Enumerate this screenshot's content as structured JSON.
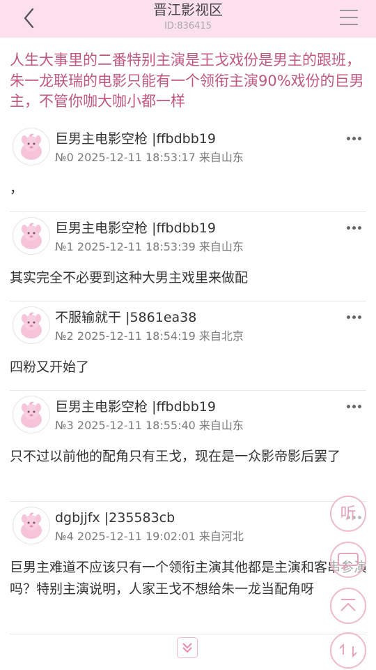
{
  "header": {
    "title": "晋江影视区",
    "thread_id": "ID:836415"
  },
  "thread": {
    "title": "人生大事里的二番特别主演是王戈戏份是男主的跟班，朱一龙联瑞的电影只能有一个领衔主演90%戏份的巨男主，不管你咖大咖小都一样"
  },
  "posts": [
    {
      "author": "巨男主电影空枪",
      "user_hash": "|ffbdbb19",
      "meta": "№0 2025-12-11 18:53:17 来自山东",
      "content": "，"
    },
    {
      "author": "巨男主电影空枪",
      "user_hash": "|ffbdbb19",
      "meta": "№1 2025-12-11 18:53:39 来自山东",
      "content": "其实完全不必要到这种大男主戏里来做配"
    },
    {
      "author": "不服输就干",
      "user_hash": "|5861ea38",
      "meta": "№2 2025-12-11 18:54:19 来自北京",
      "content": "四粉又开始了"
    },
    {
      "author": "巨男主电影空枪",
      "user_hash": "|ffbdbb19",
      "meta": "№3 2025-12-11 18:55:40 来自山东",
      "content": "只不过以前他的配角只有王戈，现在是一众影帝影后罢了"
    },
    {
      "author": "dgbjjfx",
      "user_hash": "|235583cb",
      "meta": "№4 2025-12-11 19:02:01 来自河北",
      "content": "巨男主难道不应该只有一个领衔主演其他都是主演和客串参演吗？特别主演说明，人家王戈不想给朱一龙当配角呀"
    }
  ],
  "floating": {
    "listen_label": "听"
  },
  "colors": {
    "header_bg": "#fde0ee",
    "accent": "#c0577f",
    "float_border": "#f0b8cd"
  },
  "icons": {
    "back": "chevron-left-icon",
    "menu": "hamburger-menu-icon",
    "more": "more-dots-icon",
    "reply": "reply-bubble-icon",
    "top": "scroll-top-icon",
    "refresh": "refresh-icon",
    "load_more": "double-chevron-down-icon"
  }
}
